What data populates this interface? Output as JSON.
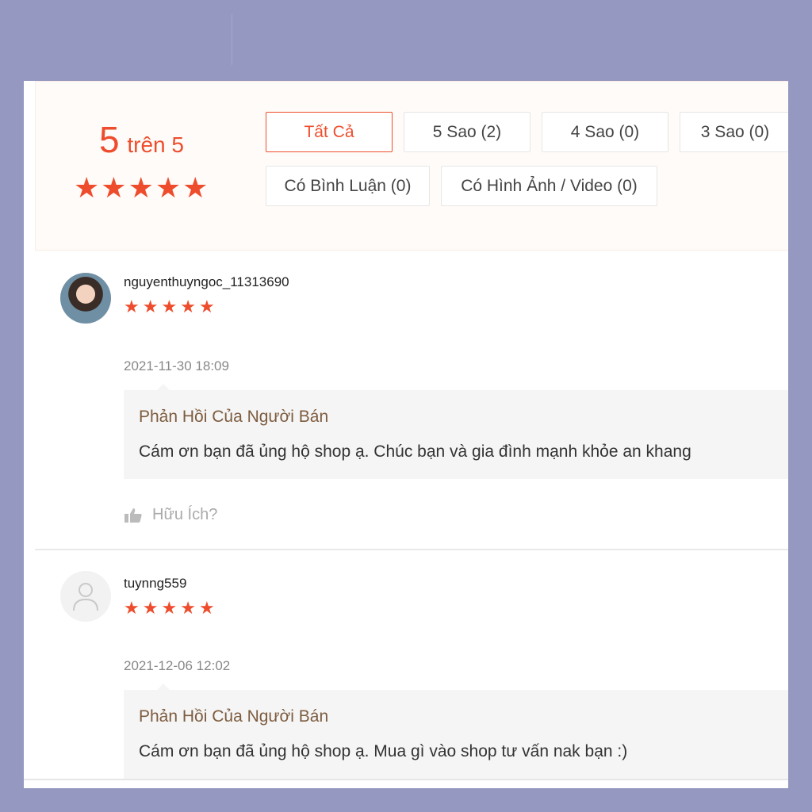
{
  "rating_overview": {
    "score": "5",
    "out_of": "trên 5",
    "stars": 5
  },
  "filters": [
    {
      "label": "Tất Cả",
      "active": true
    },
    {
      "label": "5 Sao (2)",
      "active": false
    },
    {
      "label": "4 Sao (0)",
      "active": false
    },
    {
      "label": "3 Sao (0)",
      "active": false
    },
    {
      "label": "Có Bình Luận (0)",
      "active": false
    },
    {
      "label": "Có Hình Ảnh / Video (0)",
      "active": false
    }
  ],
  "reviews": [
    {
      "username": "nguyenthuyngoc_11313690",
      "rating": 5,
      "timestamp": "2021-11-30 18:09",
      "reply_title": "Phản Hồi Của Người Bán",
      "reply_text": "Cám ơn bạn đã ủng hộ shop ạ. Chúc bạn và gia đình mạnh khỏe an khang",
      "helpful_label": "Hữu Ích?"
    },
    {
      "username": "tuynng559",
      "rating": 5,
      "timestamp": "2021-12-06 12:02",
      "reply_title": "Phản Hồi Của Người Bán",
      "reply_text": "Cám ơn bạn đã ủng hộ shop ạ. Mua gì vào shop tư vấn nak bạn :)"
    }
  ],
  "colors": {
    "accent": "#ee4d2d",
    "page_background": "#9598c1",
    "reply_title": "#7d5c3f"
  }
}
